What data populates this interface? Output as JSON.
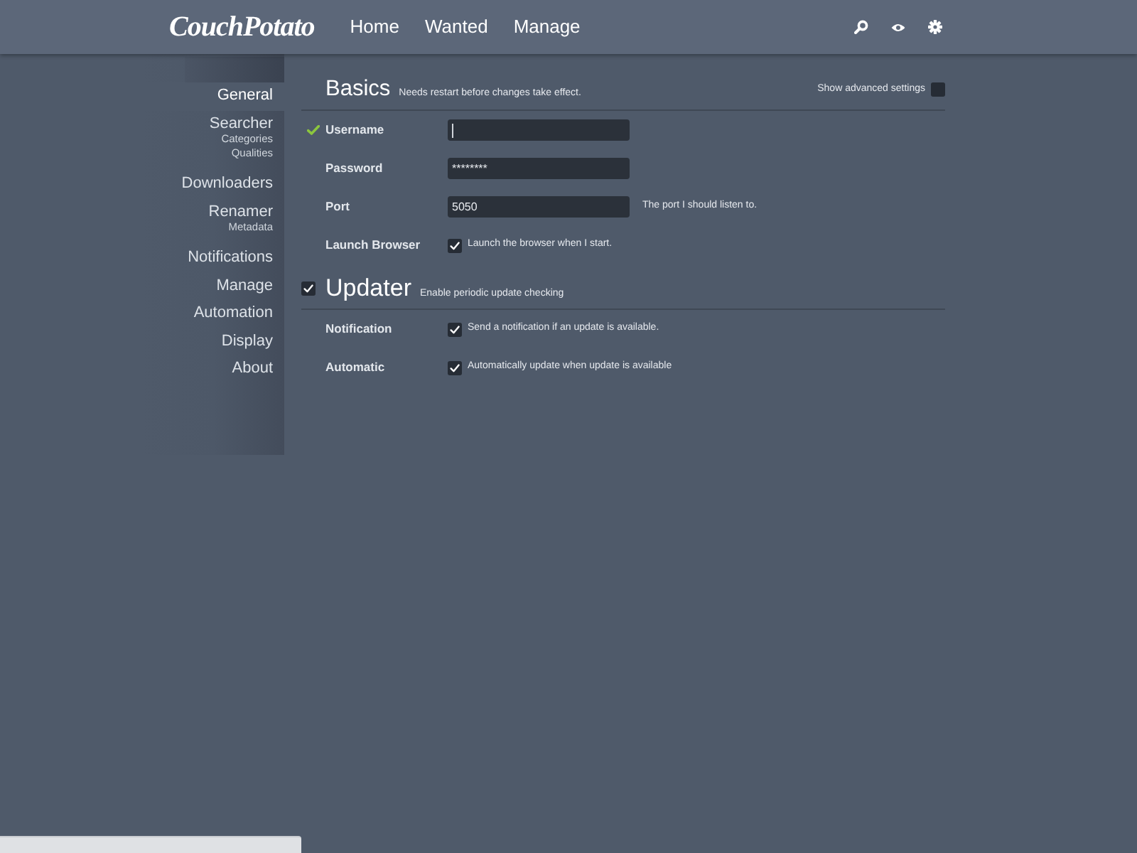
{
  "header": {
    "logo": "CouchPotato",
    "nav": [
      {
        "label": "Home"
      },
      {
        "label": "Wanted"
      },
      {
        "label": "Manage"
      }
    ]
  },
  "sidebar": {
    "items": [
      {
        "label": "General",
        "selected": true
      },
      {
        "label": "Searcher",
        "selected": false,
        "subitems": [
          "Categories",
          "Qualities"
        ]
      },
      {
        "label": "Downloaders",
        "selected": false
      },
      {
        "label": "Renamer",
        "selected": false,
        "subitems": [
          "Metadata"
        ]
      },
      {
        "label": "Notifications",
        "selected": false
      },
      {
        "label": "Manage",
        "selected": false
      },
      {
        "label": "Automation",
        "selected": false
      },
      {
        "label": "Display",
        "selected": false
      },
      {
        "label": "About",
        "selected": false
      }
    ]
  },
  "sections": [
    {
      "title": "Basics",
      "description": "Needs restart before changes take effect.",
      "advanced": {
        "label": "Show advanced settings",
        "checked": false
      },
      "fields": [
        {
          "kind": "text",
          "label": "Username",
          "focused": true,
          "valid": true
        },
        {
          "kind": "password",
          "label": "Password",
          "value": "********"
        },
        {
          "kind": "text",
          "label": "Port",
          "value": "5050",
          "hint": "The port I should listen to."
        },
        {
          "kind": "checkbox",
          "label": "Launch Browser",
          "checked": true,
          "text": "Launch the browser when I start."
        }
      ]
    },
    {
      "title": "Updater",
      "description": "Enable periodic update checking",
      "enabled": true,
      "fields": [
        {
          "kind": "checkbox",
          "label": "Notification",
          "checked": true,
          "text": "Send a notification if an update is available."
        },
        {
          "kind": "checkbox",
          "label": "Automatic",
          "checked": true,
          "text": "Automatically update when update is available"
        }
      ]
    }
  ]
}
